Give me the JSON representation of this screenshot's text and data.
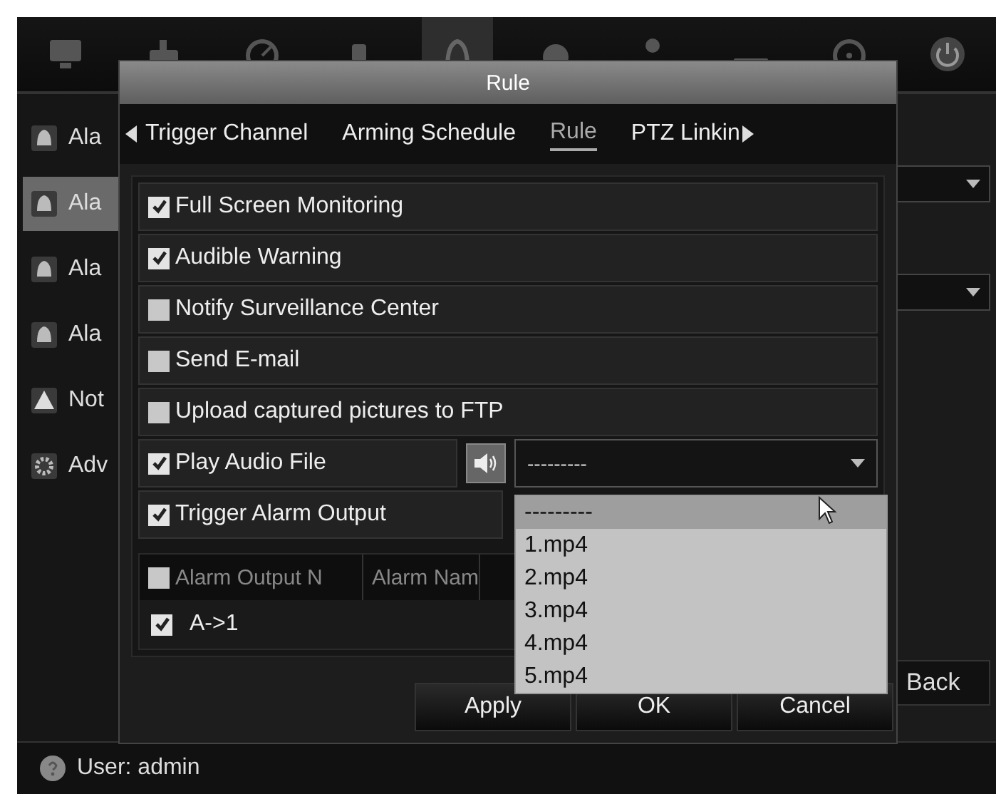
{
  "toolbar": [
    {
      "kind": "monitor",
      "selected": false
    },
    {
      "kind": "camera",
      "selected": false
    },
    {
      "kind": "gauge",
      "selected": false
    },
    {
      "kind": "square",
      "selected": false
    },
    {
      "kind": "bell",
      "selected": true
    },
    {
      "kind": "circle",
      "selected": false
    },
    {
      "kind": "person",
      "selected": false
    },
    {
      "kind": "bar",
      "selected": false
    },
    {
      "kind": "disc",
      "selected": false
    },
    {
      "kind": "power",
      "selected": false
    }
  ],
  "sidebar": {
    "items": [
      {
        "label": "Ala",
        "kind": "bell",
        "selected": false
      },
      {
        "label": "Ala",
        "kind": "bell",
        "selected": true
      },
      {
        "label": "Ala",
        "kind": "bell",
        "selected": false
      },
      {
        "label": "Ala",
        "kind": "bell",
        "selected": false
      },
      {
        "label": "Not",
        "kind": "warning",
        "selected": false
      },
      {
        "label": "Adv",
        "kind": "gear",
        "selected": false
      }
    ]
  },
  "dialog": {
    "title": "Rule",
    "tabs": [
      {
        "label": "Trigger Channel",
        "selected": false
      },
      {
        "label": "Arming Schedule",
        "selected": false
      },
      {
        "label": "Rule",
        "selected": true
      },
      {
        "label": "PTZ Linkin",
        "selected": false
      }
    ],
    "rules": [
      {
        "kind": "checkbox",
        "label": "Full Screen Monitoring",
        "checked": true
      },
      {
        "kind": "checkbox",
        "label": "Audible Warning",
        "checked": true
      },
      {
        "kind": "checkbox",
        "label": "Notify Surveillance Center",
        "checked": false
      },
      {
        "kind": "checkbox",
        "label": "Send E-mail",
        "checked": false
      },
      {
        "kind": "checkbox",
        "label": "Upload captured pictures to FTP",
        "checked": false
      },
      {
        "kind": "audio",
        "label": "Play Audio File",
        "checked": true,
        "value": "---------",
        "expanded": true,
        "options": [
          {
            "label": "---------",
            "selected": true
          },
          {
            "label": "1.mp4",
            "selected": false
          },
          {
            "label": "2.mp4",
            "selected": false
          },
          {
            "label": "3.mp4",
            "selected": false
          },
          {
            "label": "4.mp4",
            "selected": false
          },
          {
            "label": "5.mp4",
            "selected": false
          }
        ]
      },
      {
        "kind": "short",
        "label": "Trigger Alarm Output",
        "checked": true
      }
    ],
    "table": {
      "header_checked": false,
      "columns": [
        "Alarm Output N",
        "Alarm Nam"
      ],
      "rows": [
        {
          "checked": true,
          "cells": [
            "A->1"
          ]
        }
      ]
    },
    "buttons": [
      "Apply",
      "OK",
      "Cancel"
    ]
  },
  "back_button": "Back",
  "status_bar": {
    "user": "User: admin"
  }
}
